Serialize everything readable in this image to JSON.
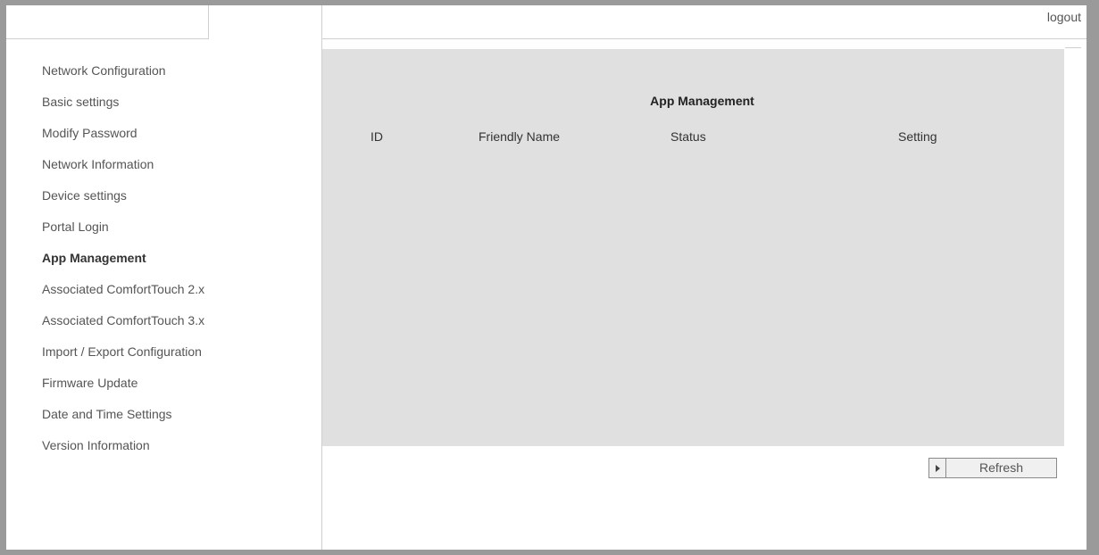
{
  "header": {
    "logout_label": "logout"
  },
  "sidebar": {
    "items": [
      {
        "label": "Network Configuration",
        "active": false
      },
      {
        "label": "Basic settings",
        "active": false
      },
      {
        "label": "Modify Password",
        "active": false
      },
      {
        "label": "Network Information",
        "active": false
      },
      {
        "label": "Device settings",
        "active": false
      },
      {
        "label": "Portal Login",
        "active": false
      },
      {
        "label": "App Management",
        "active": true
      },
      {
        "label": "Associated ComfortTouch 2.x",
        "active": false
      },
      {
        "label": "Associated ComfortTouch 3.x",
        "active": false
      },
      {
        "label": "Import / Export Configuration",
        "active": false
      },
      {
        "label": "Firmware Update",
        "active": false
      },
      {
        "label": "Date and Time Settings",
        "active": false
      },
      {
        "label": "Version Information",
        "active": false
      }
    ]
  },
  "main": {
    "title": "App Management",
    "columns": [
      "ID",
      "Friendly Name",
      "Status",
      "Setting"
    ],
    "rows": [],
    "refresh_label": "Refresh"
  },
  "colors": {
    "panel_bg": "#e0e0e0",
    "border": "#cfcfcf",
    "text": "#555555"
  },
  "icons": {
    "refresh_arrow": "play-triangle-icon"
  }
}
